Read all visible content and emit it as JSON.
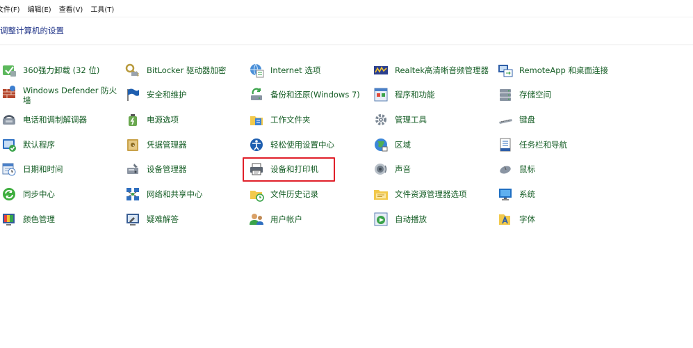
{
  "menubar": {
    "items": [
      "文件(F)",
      "编辑(E)",
      "查看(V)",
      "工具(T)"
    ]
  },
  "page": {
    "title": "调整计算机的设置"
  },
  "items": [
    {
      "label": "360强力卸载 (32 位)",
      "icon": "uninstall-icon"
    },
    {
      "label": "Windows Defender 防火墙",
      "icon": "firewall-icon"
    },
    {
      "label": "电话和调制解调器",
      "icon": "phone-modem-icon"
    },
    {
      "label": "默认程序",
      "icon": "default-programs-icon"
    },
    {
      "label": "日期和时间",
      "icon": "calendar-clock-icon"
    },
    {
      "label": "同步中心",
      "icon": "sync-icon"
    },
    {
      "label": "颜色管理",
      "icon": "color-management-icon"
    },
    {
      "label": "BitLocker 驱动器加密",
      "icon": "bitlocker-key-icon"
    },
    {
      "label": "安全和维护",
      "icon": "flag-icon"
    },
    {
      "label": "电源选项",
      "icon": "power-options-icon"
    },
    {
      "label": "凭据管理器",
      "icon": "credential-vault-icon"
    },
    {
      "label": "设备管理器",
      "icon": "device-manager-icon"
    },
    {
      "label": "网络和共享中心",
      "icon": "network-icon"
    },
    {
      "label": "疑难解答",
      "icon": "troubleshoot-icon"
    },
    {
      "label": "Internet 选项",
      "icon": "internet-options-icon"
    },
    {
      "label": "备份和还原(Windows 7)",
      "icon": "backup-restore-icon"
    },
    {
      "label": "工作文件夹",
      "icon": "work-folders-icon"
    },
    {
      "label": "轻松使用设置中心",
      "icon": "ease-of-access-icon"
    },
    {
      "label": "设备和打印机",
      "icon": "printer-icon"
    },
    {
      "label": "文件历史记录",
      "icon": "file-history-icon"
    },
    {
      "label": "用户帐户",
      "icon": "user-accounts-icon"
    },
    {
      "label": "Realtek高清晰音频管理器",
      "icon": "realtek-audio-icon"
    },
    {
      "label": "程序和功能",
      "icon": "programs-features-icon"
    },
    {
      "label": "管理工具",
      "icon": "admin-tools-icon"
    },
    {
      "label": "区域",
      "icon": "region-globe-icon"
    },
    {
      "label": "声音",
      "icon": "speaker-icon"
    },
    {
      "label": "文件资源管理器选项",
      "icon": "folder-options-icon"
    },
    {
      "label": "自动播放",
      "icon": "autoplay-icon"
    },
    {
      "label": "RemoteApp 和桌面连接",
      "icon": "remoteapp-icon"
    },
    {
      "label": "存储空间",
      "icon": "storage-spaces-icon"
    },
    {
      "label": "键盘",
      "icon": "keyboard-icon"
    },
    {
      "label": "任务栏和导航",
      "icon": "taskbar-icon"
    },
    {
      "label": "鼠标",
      "icon": "mouse-icon"
    },
    {
      "label": "系统",
      "icon": "system-monitor-icon"
    },
    {
      "label": "字体",
      "icon": "fonts-icon"
    }
  ],
  "highlighted_item": "设备和打印机",
  "colors": {
    "title": "#1e3287",
    "link": "#155d25",
    "highlight": "#e0202a"
  }
}
